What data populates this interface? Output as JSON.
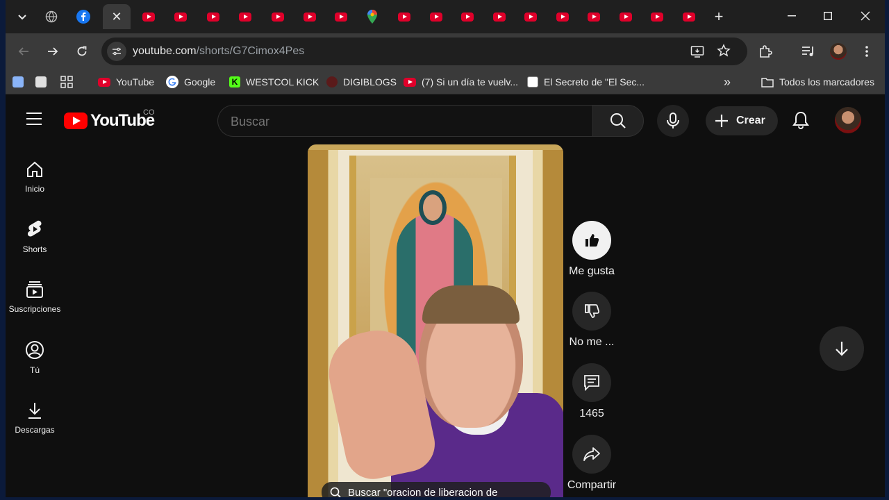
{
  "browser": {
    "tabs": [
      {
        "name": "facebook-tab"
      },
      {
        "name": "youtube-tab"
      }
    ],
    "active_tab_close": "✕",
    "new_tab": "+",
    "minimize": "—",
    "maximize": "☐",
    "close": "✕",
    "url_domain": "youtube.com",
    "url_path": "/shorts/G7Cimox4Pes",
    "bookmarks": [
      {
        "label": "YouTube",
        "icon": "youtube-icon"
      },
      {
        "label": "Google",
        "icon": "google-icon"
      },
      {
        "label": "WESTCOL KICK",
        "icon": "kick-icon"
      },
      {
        "label": "DIGIBLOGS",
        "icon": "digiblogs-icon"
      },
      {
        "label": "(7) Si un día te vuelv...",
        "icon": "youtube-icon"
      },
      {
        "label": "El Secreto de \"El Sec...",
        "icon": "site-icon"
      }
    ],
    "overflow": "»",
    "all_bookmarks": "Todos los marcadores"
  },
  "youtube": {
    "logo_text": "YouTube",
    "country": "CO",
    "search_placeholder": "Buscar",
    "create_label": "Crear",
    "sidebar": [
      {
        "label": "Inicio",
        "icon": "home-icon"
      },
      {
        "label": "Shorts",
        "icon": "shorts-icon"
      },
      {
        "label": "Suscripciones",
        "icon": "subscriptions-icon"
      },
      {
        "label": "Tú",
        "icon": "you-icon"
      },
      {
        "label": "Descargas",
        "icon": "download-icon"
      }
    ],
    "short_search_text": "Buscar \"oracion de liberacion de",
    "actions": {
      "like": "Me gusta",
      "dislike": "No me ...",
      "comments": "1465",
      "share": "Compartir"
    }
  },
  "colors": {
    "accent": "#ff0000",
    "background": "#0f0f0f"
  }
}
